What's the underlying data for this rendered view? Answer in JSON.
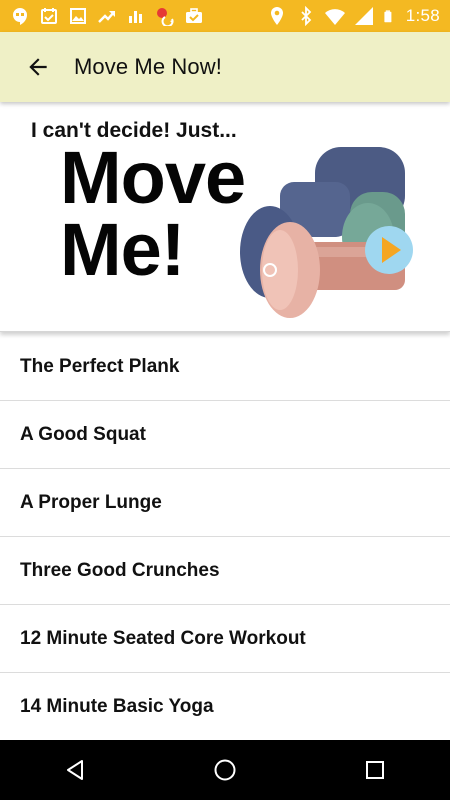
{
  "status_bar": {
    "time": "1:58",
    "left_icons": [
      "hangouts-icon",
      "calendar-check-icon",
      "image-icon",
      "trending-icon",
      "bar-chart-icon",
      "notification-alert-icon",
      "briefcase-check-icon"
    ],
    "right_icons": [
      "location-icon",
      "bluetooth-icon",
      "wifi-icon",
      "signal-icon",
      "battery-icon"
    ],
    "background_color": "#f4b922"
  },
  "toolbar": {
    "title": "Move Me Now!",
    "back_icon": "arrow-back-icon",
    "background_color": "#eff0c6"
  },
  "hero": {
    "subtitle": "I can't decide! Just...",
    "big_line_1": "Move",
    "big_line_2": "Me!",
    "play_icon": "play-icon",
    "accent_color": "#f5a623"
  },
  "workouts": [
    {
      "label": "The Perfect Plank"
    },
    {
      "label": "A Good Squat"
    },
    {
      "label": "A Proper Lunge"
    },
    {
      "label": "Three Good Crunches"
    },
    {
      "label": "12 Minute Seated Core Workout"
    },
    {
      "label": "14 Minute Basic Yoga"
    }
  ],
  "nav_bar": {
    "buttons": [
      "back-triangle-icon",
      "home-circle-icon",
      "recents-square-icon"
    ]
  }
}
